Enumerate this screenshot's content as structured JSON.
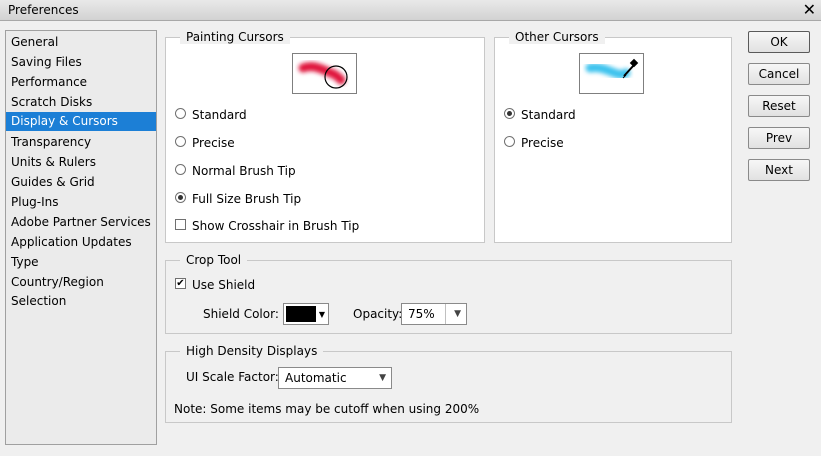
{
  "window": {
    "title": "Preferences",
    "close_glyph": "✕"
  },
  "sidebar": {
    "items": [
      {
        "label": "General"
      },
      {
        "label": "Saving Files"
      },
      {
        "label": "Performance"
      },
      {
        "label": "Scratch Disks"
      },
      {
        "label": "Display & Cursors"
      },
      {
        "label": "Transparency"
      },
      {
        "label": "Units & Rulers"
      },
      {
        "label": "Guides & Grid"
      },
      {
        "label": "Plug-Ins"
      },
      {
        "label": "Adobe Partner Services"
      },
      {
        "label": "Application Updates"
      },
      {
        "label": "Type"
      },
      {
        "label": "Country/Region Selection"
      }
    ],
    "selected_index": 4
  },
  "painting_cursors": {
    "legend": "Painting Cursors",
    "options": [
      "Standard",
      "Precise",
      "Normal Brush Tip",
      "Full Size Brush Tip"
    ],
    "selected": "Full Size Brush Tip",
    "crosshair_label": "Show Crosshair in Brush Tip",
    "crosshair_checked": false,
    "preview_color": "#e0193c"
  },
  "other_cursors": {
    "legend": "Other Cursors",
    "options": [
      "Standard",
      "Precise"
    ],
    "selected": "Standard",
    "preview_color": "#3ec3ee"
  },
  "crop_tool": {
    "legend": "Crop Tool",
    "use_shield_label": "Use Shield",
    "use_shield_checked": true,
    "shield_color_label": "Shield Color:",
    "shield_color": "#000000",
    "opacity_label": "Opacity:",
    "opacity_value": "75%"
  },
  "high_density": {
    "legend": "High Density Displays",
    "ui_scale_label": "UI Scale Factor:",
    "ui_scale_value": "Automatic",
    "note": "Note: Some items may be cutoff when using 200%"
  },
  "buttons": {
    "ok": "OK",
    "cancel": "Cancel",
    "reset": "Reset",
    "prev": "Prev",
    "next": "Next"
  }
}
